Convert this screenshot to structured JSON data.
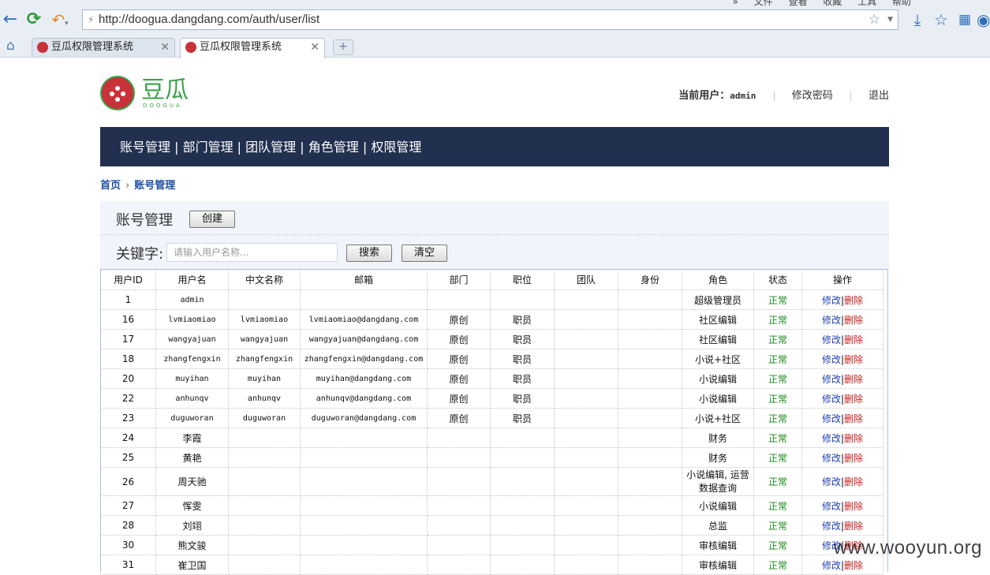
{
  "browser": {
    "menu": [
      "»",
      "文件",
      "查看",
      "收藏",
      "工具",
      "帮助"
    ],
    "url": "http://doogua.dangdang.com/auth/user/list",
    "tabs": [
      {
        "title": "豆瓜权限管理系统",
        "active": false
      },
      {
        "title": "豆瓜权限管理系统",
        "active": true
      }
    ],
    "new_tab": "+"
  },
  "brand": {
    "name": "豆瓜",
    "sub": "DOOGUA",
    "primary": "#c8323a",
    "green": "#3aa34a"
  },
  "userbar": {
    "current_label": "当前用户：",
    "username": "admin",
    "change_password": "修改密码",
    "logout": "退出"
  },
  "nav": {
    "items": [
      "账号管理",
      "部门管理",
      "团队管理",
      "角色管理",
      "权限管理"
    ],
    "separator": " | ",
    "bg": "#22304f"
  },
  "breadcrumb": {
    "home": "首页",
    "current": "账号管理"
  },
  "panel": {
    "title": "账号管理",
    "create_label": "创建",
    "keyword_label": "关键字:",
    "search_placeholder": "请输入用户名称...",
    "search_label": "搜索",
    "clear_label": "清空"
  },
  "table": {
    "columns": [
      "用户ID",
      "用户名",
      "中文名称",
      "邮箱",
      "部门",
      "职位",
      "团队",
      "身份",
      "角色",
      "状态",
      "操作"
    ],
    "edit_label": "修改",
    "delete_label": "删除",
    "op_sep": "|",
    "rows": [
      {
        "id": "1",
        "username": "admin",
        "cn": "",
        "email": "",
        "dept": "",
        "pos": "",
        "team": "",
        "identity": "",
        "role": "超级管理员",
        "status": "正常"
      },
      {
        "id": "16",
        "username": "lvmiaomiao",
        "cn": "lvmiaomiao",
        "email": "lvmiaomiao@dangdang.com",
        "dept": "原创",
        "pos": "职员",
        "team": "",
        "identity": "",
        "role": "社区编辑",
        "status": "正常"
      },
      {
        "id": "17",
        "username": "wangyajuan",
        "cn": "wangyajuan",
        "email": "wangyajuan@dangdang.com",
        "dept": "原创",
        "pos": "职员",
        "team": "",
        "identity": "",
        "role": "社区编辑",
        "status": "正常"
      },
      {
        "id": "18",
        "username": "zhangfengxin",
        "cn": "zhangfengxin",
        "email": "zhangfengxin@dangdang.com",
        "dept": "原创",
        "pos": "职员",
        "team": "",
        "identity": "",
        "role": "小说+社区",
        "status": "正常"
      },
      {
        "id": "20",
        "username": "muyihan",
        "cn": "muyihan",
        "email": "muyihan@dangdang.com",
        "dept": "原创",
        "pos": "职员",
        "team": "",
        "identity": "",
        "role": "小说编辑",
        "status": "正常"
      },
      {
        "id": "22",
        "username": "anhunqv",
        "cn": "anhunqv",
        "email": "anhunqv@dangdang.com",
        "dept": "原创",
        "pos": "职员",
        "team": "",
        "identity": "",
        "role": "小说编辑",
        "status": "正常"
      },
      {
        "id": "23",
        "username": "duguworan",
        "cn": "duguworan",
        "email": "duguworan@dangdang.com",
        "dept": "原创",
        "pos": "职员",
        "team": "",
        "identity": "",
        "role": "小说+社区",
        "status": "正常"
      },
      {
        "id": "24",
        "username": "李霞",
        "cn": "",
        "email": "",
        "dept": "",
        "pos": "",
        "team": "",
        "identity": "",
        "role": "财务",
        "status": "正常"
      },
      {
        "id": "25",
        "username": "黄艳",
        "cn": "",
        "email": "",
        "dept": "",
        "pos": "",
        "team": "",
        "identity": "",
        "role": "财务",
        "status": "正常"
      },
      {
        "id": "26",
        "username": "周天驰",
        "cn": "",
        "email": "",
        "dept": "",
        "pos": "",
        "team": "",
        "identity": "",
        "role": "小说编辑, 运营数据查询",
        "status": "正常"
      },
      {
        "id": "27",
        "username": "恽雯",
        "cn": "",
        "email": "",
        "dept": "",
        "pos": "",
        "team": "",
        "identity": "",
        "role": "小说编辑",
        "status": "正常"
      },
      {
        "id": "28",
        "username": "刘翊",
        "cn": "",
        "email": "",
        "dept": "",
        "pos": "",
        "team": "",
        "identity": "",
        "role": "总监",
        "status": "正常"
      },
      {
        "id": "30",
        "username": "熊文骏",
        "cn": "",
        "email": "",
        "dept": "",
        "pos": "",
        "team": "",
        "identity": "",
        "role": "审核编辑",
        "status": "正常"
      },
      {
        "id": "31",
        "username": "崔卫国",
        "cn": "",
        "email": "",
        "dept": "",
        "pos": "",
        "team": "",
        "identity": "",
        "role": "审核编辑",
        "status": "正常"
      }
    ]
  },
  "watermark": "www.wooyun.org"
}
